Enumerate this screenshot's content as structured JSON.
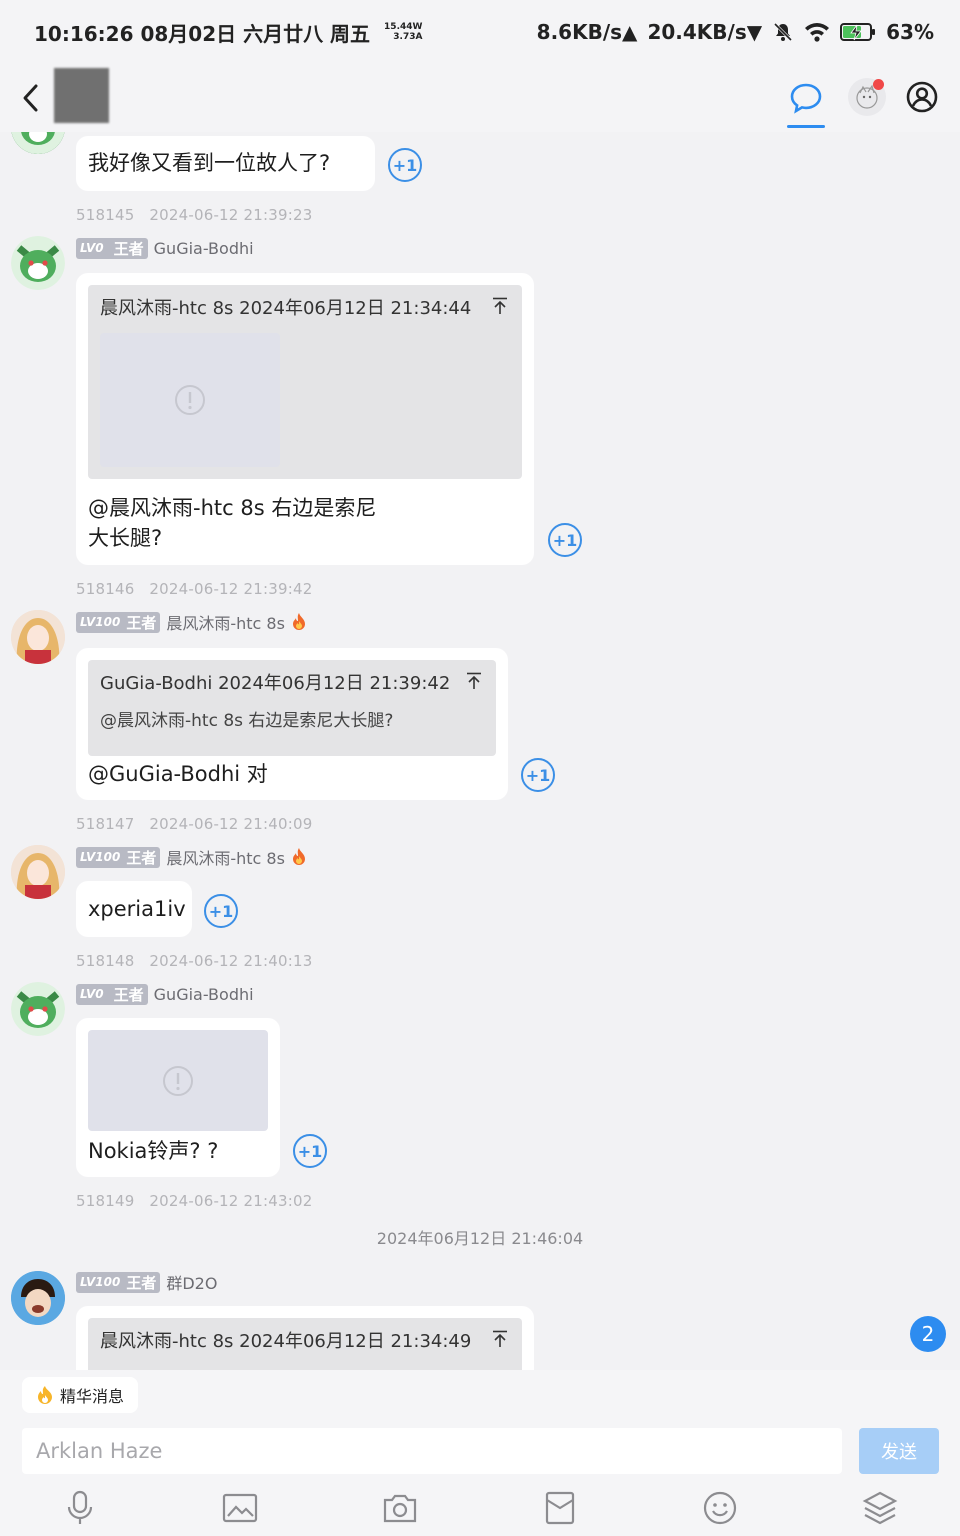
{
  "status_bar": {
    "time": "10:16:26 08月02日 六月廿八 周五",
    "power_top": "15.44W",
    "power_bottom": "3.73A",
    "net_up": "8.6KB/s▲",
    "net_down": "20.4KB/s▼",
    "battery": "63%"
  },
  "top_message": {
    "text": "我好像又看到一位故人了?",
    "plus": "+1",
    "stamp_id": "518145",
    "stamp_time": "2024-06-12 21:39:23"
  },
  "messages": [
    {
      "level": "LV0",
      "rank": "王者",
      "user": "GuGia-Bodhi",
      "quote_header": "晨风沐雨-htc 8s 2024年06月12日 21:34:44",
      "text_line1": "@晨风沐雨-htc 8s 右边是索尼",
      "text_line2": "大长腿?",
      "plus": "+1",
      "stamp_id": "518146",
      "stamp_time": "2024-06-12 21:39:42"
    },
    {
      "level": "LV100",
      "rank": "王者",
      "user": "晨风沐雨-htc 8s",
      "quote_header": "GuGia-Bodhi 2024年06月12日 21:39:42",
      "quote_text": "@晨风沐雨-htc 8s 右边是索尼大长腿?",
      "text": "@GuGia-Bodhi 对",
      "plus": "+1",
      "stamp_id": "518147",
      "stamp_time": "2024-06-12 21:40:09"
    },
    {
      "level": "LV100",
      "rank": "王者",
      "user": "晨风沐雨-htc 8s",
      "text": "xperia1iv",
      "plus": "+1",
      "stamp_id": "518148",
      "stamp_time": "2024-06-12 21:40:13"
    },
    {
      "level": "LV0",
      "rank": "王者",
      "user": "GuGia-Bodhi",
      "text": "Nokia铃声? ?",
      "plus": "+1",
      "stamp_id": "518149",
      "stamp_time": "2024-06-12 21:43:02"
    },
    {
      "level": "LV100",
      "rank": "王者",
      "user": "群D2O",
      "quote_header": "晨风沐雨-htc 8s 2024年06月12日 21:34:49"
    }
  ],
  "center_time": "2024年06月12日 21:46:04",
  "unread_badge": "2",
  "bottom": {
    "pill_label": "精华消息",
    "input_placeholder": "Arklan Haze",
    "send_label": "发送"
  },
  "colors": {
    "accent": "#2d8cf0",
    "send_disabled": "#a7cef7",
    "level_badge": "#b8bac4"
  }
}
